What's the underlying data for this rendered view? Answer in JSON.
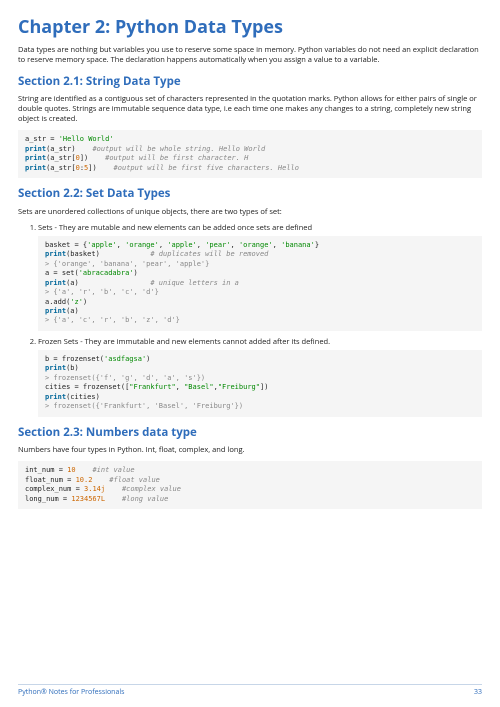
{
  "title": "Chapter 2: Python Data Types",
  "intro": "Data types are nothing but variables you use to reserve some space in memory. Python variables do not need an explicit declaration to reserve memory space. The declaration happens automatically when you assign a value to a variable.",
  "section1": {
    "heading": "Section 2.1: String Data Type",
    "para": "String are identified as a contiguous set of characters represented in the quotation marks. Python allows for either pairs of single or double quotes. Strings are immutable sequence data type, i.e each time one makes any changes to a string, completely new string object is created."
  },
  "section2": {
    "heading": "Section 2.2: Set Data Types",
    "para": "Sets are unordered collections of unique objects, there are two types of set:",
    "li1": "Sets - They are mutable and new elements can be added once sets are defined",
    "li2": "Frozen Sets - They are immutable and new elements cannot added after its defined."
  },
  "section3": {
    "heading": "Section 2.3: Numbers data type",
    "para": "Numbers have four types in Python. Int, float, complex, and long."
  },
  "footer": {
    "left": "Python® Notes for Professionals",
    "right": "33"
  },
  "chart_data": {
    "type": "table",
    "note": "Code blocks content as displayed in the document",
    "code_blocks": [
      {
        "id": "string_example",
        "lines": [
          "a_str = 'Hello World'",
          "print(a_str)    #output will be whole string. Hello World",
          "print(a_str[0])    #output will be first character. H",
          "print(a_str[0:5])    #output will be first five characters. Hello"
        ]
      },
      {
        "id": "set_example",
        "lines": [
          "basket = {'apple', 'orange', 'apple', 'pear', 'orange', 'banana'}",
          "print(basket)            # duplicates will be removed",
          "> {'orange', 'banana', 'pear', 'apple'}",
          "a = set('abracadabra')",
          "print(a)                 # unique letters in a",
          "> {'a', 'r', 'b', 'c', 'd'}",
          "a.add('z')",
          "print(a)",
          "> {'a', 'c', 'r', 'b', 'z', 'd'}"
        ]
      },
      {
        "id": "frozenset_example",
        "lines": [
          "b = frozenset('asdfagsa')",
          "print(b)",
          "> frozenset({'f', 'g', 'd', 'a', 's'})",
          "cities = frozenset([\"Frankfurt\", \"Basel\",\"Freiburg\"])",
          "print(cities)",
          "> frozenset({'Frankfurt', 'Basel', 'Freiburg'})"
        ]
      },
      {
        "id": "numbers_example",
        "lines": [
          "int_num = 10    #int value",
          "float_num = 10.2    #float value",
          "complex_num = 3.14j    #complex value",
          "long_num = 1234567L    #long value"
        ]
      }
    ]
  }
}
